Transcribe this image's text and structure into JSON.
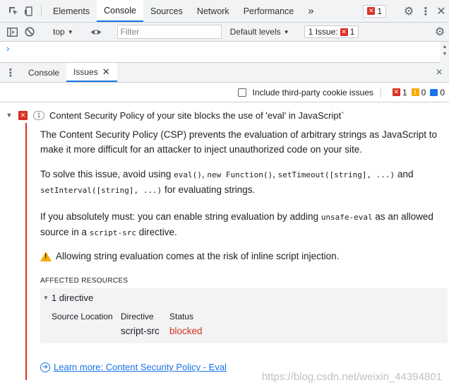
{
  "topbar": {
    "tabs": [
      "Elements",
      "Console",
      "Sources",
      "Network",
      "Performance"
    ],
    "more": "»",
    "error_count": "1"
  },
  "console_toolbar": {
    "context": "top",
    "filter_placeholder": "Filter",
    "levels": "Default levels",
    "issues_label": "1 Issue:",
    "issues_count": "1"
  },
  "console": {
    "prompt": "›"
  },
  "drawer": {
    "tabs": [
      "Console",
      "Issues"
    ],
    "close": "×"
  },
  "issues_toolbar": {
    "third_party": "Include third-party cookie issues",
    "errors": "1",
    "warnings": "0",
    "info": "0"
  },
  "issue": {
    "count": "1",
    "title": "Content Security Policy of your site blocks the use of 'eval' in JavaScript`",
    "p1": "The Content Security Policy (CSP) prevents the evaluation of arbitrary strings as JavaScript to make it more difficult for an attacker to inject unauthorized code on your site.",
    "p2_a": "To solve this issue, avoid using ",
    "p2_c1": "eval()",
    "p2_b": ", ",
    "p2_c2": "new Function()",
    "p2_b2": ", ",
    "p2_c3": "setTimeout([string], ...)",
    "p2_d": " and ",
    "p2_c4": "setInterval([string], ...)",
    "p2_e": " for evaluating strings.",
    "p3_a": "If you absolutely must: you can enable string evaluation by adding ",
    "p3_c1": "unsafe-eval",
    "p3_b": " as an allowed source in a ",
    "p3_c2": "script-src",
    "p3_e": " directive.",
    "warning": "Allowing string evaluation comes at the risk of inline script injection.",
    "affected_heading": "AFFECTED RESOURCES",
    "resource_summary": "1 directive",
    "columns": [
      "Source Location",
      "Directive",
      "Status"
    ],
    "directive": "script-src",
    "status": "blocked",
    "learn_more": "Learn more: Content Security Policy - Eval"
  },
  "watermark": "https://blog.csdn.net/weixin_44394801",
  "colors": {
    "accent": "#1a73e8",
    "error": "#d93025",
    "warning": "#f9ab00"
  }
}
